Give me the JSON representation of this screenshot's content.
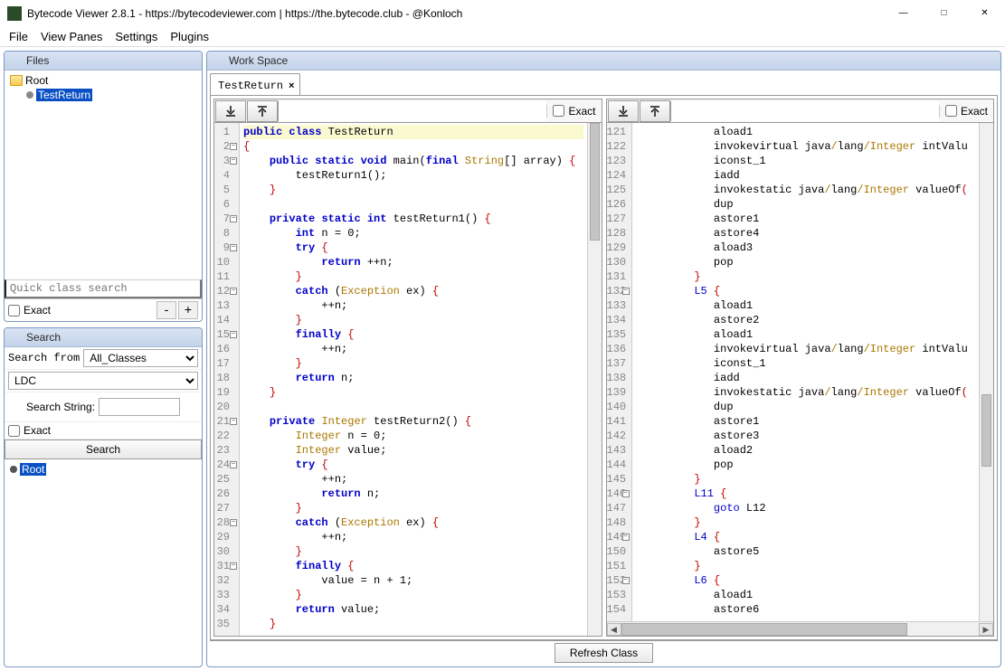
{
  "window": {
    "title": "Bytecode Viewer 2.8.1 - https://bytecodeviewer.com | https://the.bytecode.club - @Konloch"
  },
  "menu": {
    "file": "File",
    "view_panes": "View Panes",
    "settings": "Settings",
    "plugins": "Plugins"
  },
  "files_panel": {
    "title": "Files",
    "root_label": "Root",
    "selected_item": "TestReturn",
    "quick_search_placeholder": "Quick class search",
    "exact_label": "Exact",
    "minus": "-",
    "plus": "+"
  },
  "search_panel": {
    "title": "Search",
    "search_from_label": "Search from",
    "search_from_value": "All_Classes",
    "type_value": "LDC",
    "search_string_label": "Search String:",
    "search_string_value": "",
    "exact_label": "Exact",
    "search_button": "Search",
    "result_root": "Root"
  },
  "workspace": {
    "title": "Work Space",
    "tab_label": "TestReturn",
    "tab_close": "×",
    "exact_label": "Exact",
    "refresh_button": "Refresh Class"
  },
  "left_code": {
    "start_line": 1,
    "lines": [
      {
        "n": 1,
        "fold": "",
        "html": "<span class='hl-line'><span class='kw'>public</span> <span class='kw'>class</span> TestReturn</span>"
      },
      {
        "n": 2,
        "fold": "-",
        "html": "<span class='pun'>{</span>"
      },
      {
        "n": 3,
        "fold": "-",
        "html": "    <span class='kw'>public</span> <span class='kw'>static</span> <span class='kw'>void</span> main(<span class='kw'>final</span> <span class='typ'>String</span>[] array) <span class='pun'>{</span>"
      },
      {
        "n": 4,
        "fold": "",
        "html": "        testReturn1();"
      },
      {
        "n": 5,
        "fold": "",
        "html": "    <span class='pun'>}</span>"
      },
      {
        "n": 6,
        "fold": "",
        "html": ""
      },
      {
        "n": 7,
        "fold": "-",
        "html": "    <span class='kw'>private</span> <span class='kw'>static</span> <span class='kw'>int</span> testReturn1() <span class='pun'>{</span>"
      },
      {
        "n": 8,
        "fold": "",
        "html": "        <span class='kw'>int</span> n = <span class='num'>0</span>;"
      },
      {
        "n": 9,
        "fold": "-",
        "html": "        <span class='kw'>try</span> <span class='pun'>{</span>"
      },
      {
        "n": 10,
        "fold": "",
        "html": "            <span class='kw'>return</span> ++n;"
      },
      {
        "n": 11,
        "fold": "",
        "html": "        <span class='pun'>}</span>"
      },
      {
        "n": 12,
        "fold": "-",
        "html": "        <span class='kw'>catch</span> (<span class='typ'>Exception</span> ex) <span class='pun'>{</span>"
      },
      {
        "n": 13,
        "fold": "",
        "html": "            ++n;"
      },
      {
        "n": 14,
        "fold": "",
        "html": "        <span class='pun'>}</span>"
      },
      {
        "n": 15,
        "fold": "-",
        "html": "        <span class='kw'>finally</span> <span class='pun'>{</span>"
      },
      {
        "n": 16,
        "fold": "",
        "html": "            ++n;"
      },
      {
        "n": 17,
        "fold": "",
        "html": "        <span class='pun'>}</span>"
      },
      {
        "n": 18,
        "fold": "",
        "html": "        <span class='kw'>return</span> n;"
      },
      {
        "n": 19,
        "fold": "",
        "html": "    <span class='pun'>}</span>"
      },
      {
        "n": 20,
        "fold": "",
        "html": ""
      },
      {
        "n": 21,
        "fold": "-",
        "html": "    <span class='kw'>private</span> <span class='typ'>Integer</span> testReturn2() <span class='pun'>{</span>"
      },
      {
        "n": 22,
        "fold": "",
        "html": "        <span class='typ'>Integer</span> n = <span class='num'>0</span>;"
      },
      {
        "n": 23,
        "fold": "",
        "html": "        <span class='typ'>Integer</span> value;"
      },
      {
        "n": 24,
        "fold": "-",
        "html": "        <span class='kw'>try</span> <span class='pun'>{</span>"
      },
      {
        "n": 25,
        "fold": "",
        "html": "            ++n;"
      },
      {
        "n": 26,
        "fold": "",
        "html": "            <span class='kw'>return</span> n;"
      },
      {
        "n": 27,
        "fold": "",
        "html": "        <span class='pun'>}</span>"
      },
      {
        "n": 28,
        "fold": "-",
        "html": "        <span class='kw'>catch</span> (<span class='typ'>Exception</span> ex) <span class='pun'>{</span>"
      },
      {
        "n": 29,
        "fold": "",
        "html": "            ++n;"
      },
      {
        "n": 30,
        "fold": "",
        "html": "        <span class='pun'>}</span>"
      },
      {
        "n": 31,
        "fold": "-",
        "html": "        <span class='kw'>finally</span> <span class='pun'>{</span>"
      },
      {
        "n": 32,
        "fold": "",
        "html": "            value = n + <span class='num'>1</span>;"
      },
      {
        "n": 33,
        "fold": "",
        "html": "        <span class='pun'>}</span>"
      },
      {
        "n": 34,
        "fold": "",
        "html": "        <span class='kw'>return</span> value;"
      },
      {
        "n": 35,
        "fold": "",
        "html": "    <span class='pun'>}</span>"
      }
    ]
  },
  "right_code": {
    "lines": [
      {
        "n": 121,
        "fold": "",
        "html": "            aload1"
      },
      {
        "n": 122,
        "fold": "",
        "html": "            invokevirtual java<span class='typ'>/</span>lang<span class='typ'>/</span><span class='typ'>Integer</span> intValu"
      },
      {
        "n": 123,
        "fold": "",
        "html": "            iconst_1"
      },
      {
        "n": 124,
        "fold": "",
        "html": "            iadd"
      },
      {
        "n": 125,
        "fold": "",
        "html": "            invokestatic java<span class='typ'>/</span>lang<span class='typ'>/</span><span class='typ'>Integer</span> valueOf<span class='pun'>(</span>"
      },
      {
        "n": 126,
        "fold": "",
        "html": "            dup"
      },
      {
        "n": 127,
        "fold": "",
        "html": "            astore1"
      },
      {
        "n": 128,
        "fold": "",
        "html": "            astore4"
      },
      {
        "n": 129,
        "fold": "",
        "html": "            aload3"
      },
      {
        "n": 130,
        "fold": "",
        "html": "            pop"
      },
      {
        "n": 131,
        "fold": "",
        "html": "         <span class='pun'>}</span>"
      },
      {
        "n": 132,
        "fold": "-",
        "html": "         <span class='kw2'>L5</span> <span class='pun'>{</span>"
      },
      {
        "n": 133,
        "fold": "",
        "html": "            aload1"
      },
      {
        "n": 134,
        "fold": "",
        "html": "            astore2"
      },
      {
        "n": 135,
        "fold": "",
        "html": "            aload1"
      },
      {
        "n": 136,
        "fold": "",
        "html": "            invokevirtual java<span class='typ'>/</span>lang<span class='typ'>/</span><span class='typ'>Integer</span> intValu"
      },
      {
        "n": 137,
        "fold": "",
        "html": "            iconst_1"
      },
      {
        "n": 138,
        "fold": "",
        "html": "            iadd"
      },
      {
        "n": 139,
        "fold": "",
        "html": "            invokestatic java<span class='typ'>/</span>lang<span class='typ'>/</span><span class='typ'>Integer</span> valueOf<span class='pun'>(</span>"
      },
      {
        "n": 140,
        "fold": "",
        "html": "            dup"
      },
      {
        "n": 141,
        "fold": "",
        "html": "            astore1"
      },
      {
        "n": 142,
        "fold": "",
        "html": "            astore3"
      },
      {
        "n": 143,
        "fold": "",
        "html": "            aload2"
      },
      {
        "n": 144,
        "fold": "",
        "html": "            pop"
      },
      {
        "n": 145,
        "fold": "",
        "html": "         <span class='pun'>}</span>"
      },
      {
        "n": 146,
        "fold": "-",
        "html": "         <span class='kw2'>L11</span> <span class='pun'>{</span>"
      },
      {
        "n": 147,
        "fold": "",
        "html": "            <span class='kw2'>goto</span> L12"
      },
      {
        "n": 148,
        "fold": "",
        "html": "         <span class='pun'>}</span>"
      },
      {
        "n": 149,
        "fold": "-",
        "html": "         <span class='kw2'>L4</span> <span class='pun'>{</span>"
      },
      {
        "n": 150,
        "fold": "",
        "html": "            astore5"
      },
      {
        "n": 151,
        "fold": "",
        "html": "         <span class='pun'>}</span>"
      },
      {
        "n": 152,
        "fold": "-",
        "html": "         <span class='kw2'>L6</span> <span class='pun'>{</span>"
      },
      {
        "n": 153,
        "fold": "",
        "html": "            aload1"
      },
      {
        "n": 154,
        "fold": "",
        "html": "            astore6"
      }
    ]
  }
}
